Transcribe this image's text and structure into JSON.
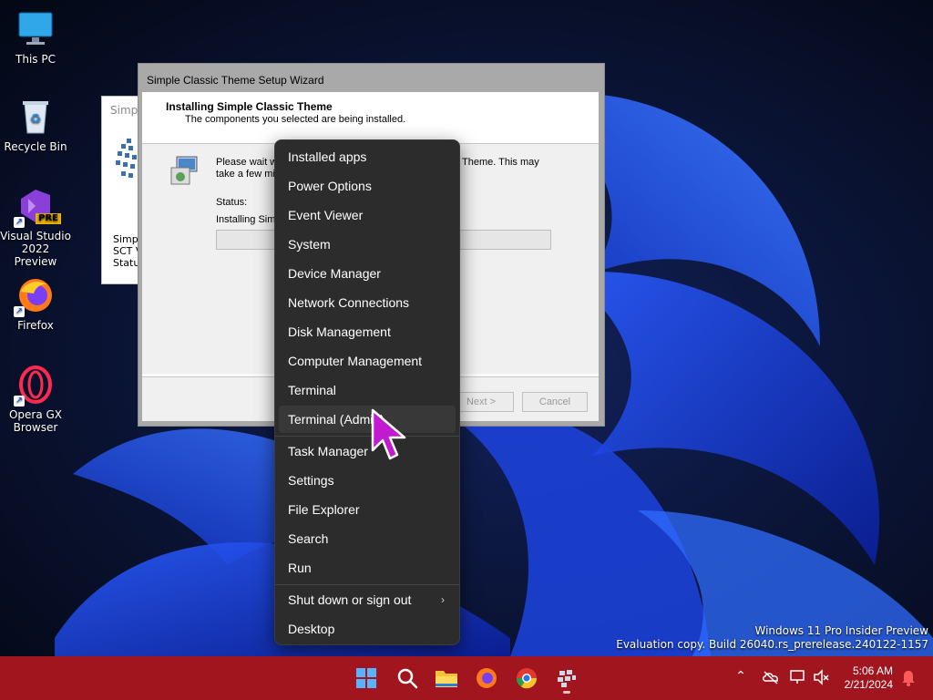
{
  "desktop": {
    "icons": [
      {
        "label": "This PC"
      },
      {
        "label": "Recycle Bin"
      },
      {
        "label_line1": "Visual Studio",
        "label_line2": "2022 Preview",
        "badge": "PRE"
      },
      {
        "label": "Firefox"
      },
      {
        "label_line1": "Opera GX",
        "label_line2": "Browser"
      }
    ]
  },
  "bg_window": {
    "title": "Simpl",
    "line1": "Simple",
    "line2": "SCT V",
    "line3": "Status"
  },
  "wizard": {
    "title": "Simple Classic Theme Setup Wizard",
    "heading": "Installing Simple Classic Theme",
    "subheading": "The components you selected are being installed.",
    "message_line1_start": "Please wait w",
    "message_line1_end": "Theme. This may",
    "message_line2": "take a few mi",
    "status_label": "Status:",
    "status_value": "Installing Simp",
    "next_label": "Next >",
    "cancel_label": "Cancel"
  },
  "menu": {
    "items": [
      {
        "label": "Installed apps"
      },
      {
        "label": "Power Options"
      },
      {
        "label": "Event Viewer"
      },
      {
        "label": "System"
      },
      {
        "label": "Device Manager"
      },
      {
        "label": "Network Connections"
      },
      {
        "label": "Disk Management"
      },
      {
        "label": "Computer Management"
      },
      {
        "label": "Terminal"
      },
      {
        "label": "Terminal (Admin)"
      },
      {
        "label": "Task Manager"
      },
      {
        "label": "Settings"
      },
      {
        "label": "File Explorer"
      },
      {
        "label": "Search"
      },
      {
        "label": "Run"
      },
      {
        "label": "Shut down or sign out"
      },
      {
        "label": "Desktop"
      }
    ],
    "chevron": "›"
  },
  "watermark": {
    "line1": "Windows 11 Pro Insider Preview",
    "line2": "Evaluation copy. Build 26040.rs_prerelease.240122-1157"
  },
  "taskbar": {
    "time": "5:06 AM",
    "date": "2/21/2024",
    "color": "#a1151f"
  }
}
